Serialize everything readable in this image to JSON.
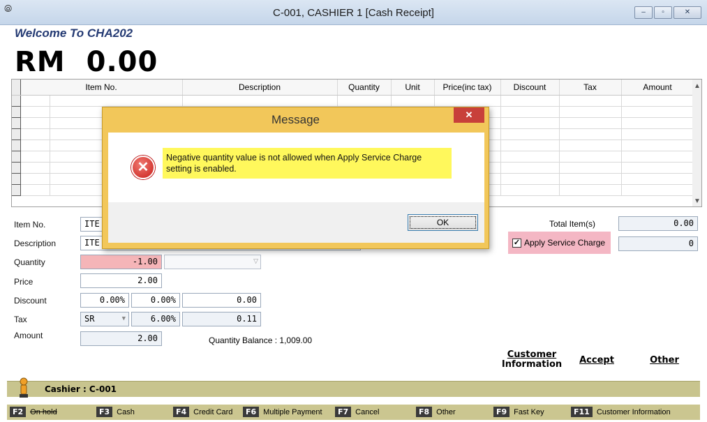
{
  "window": {
    "title": "C-001, CASHIER 1 [Cash Receipt]",
    "minimize": "–",
    "maximize": "▫",
    "close": "✕"
  },
  "header": {
    "welcome": "Welcome To CHA202",
    "currency": "RM",
    "total": "0.00"
  },
  "grid": {
    "columns": [
      "Item No.",
      "Description",
      "Quantity",
      "Unit",
      "Price(inc tax)",
      "Discount",
      "Tax",
      "Amount"
    ]
  },
  "form": {
    "item_no_label": "Item No.",
    "item_no_value": "ITE",
    "description_label": "Description",
    "description_value": "ITE",
    "quantity_label": "Quantity",
    "quantity_value": "-1.00",
    "price_label": "Price",
    "price_value": "2.00",
    "discount_label": "Discount",
    "discount_pct1": "0.00%",
    "discount_pct2": "0.00%",
    "discount_amount": "0.00",
    "tax_label": "Tax",
    "tax_code": "SR",
    "tax_rate": "6.00%",
    "tax_amount": "0.11",
    "amount_label": "Amount",
    "amount_value": "2.00",
    "quantity_balance": "Quantity Balance : 1,009.00"
  },
  "totals": {
    "total_items_label": "Total Item(s)",
    "total_items_value": "0.00",
    "service_charge_label": "Apply Service Charge",
    "service_charge_value": "0",
    "service_charge_checked": true
  },
  "actions": {
    "customer_information_line1": "Customer",
    "customer_information_line2": "Information",
    "accept": "Accept",
    "other": "Other"
  },
  "status": {
    "cashier": "Cashier : C-001"
  },
  "fkeys": [
    {
      "key": "F2",
      "label": "On hold"
    },
    {
      "key": "F3",
      "label": "Cash"
    },
    {
      "key": "F4",
      "label": "Credit Card"
    },
    {
      "key": "F6",
      "label": "Multiple Payment"
    },
    {
      "key": "F7",
      "label": "Cancel"
    },
    {
      "key": "F8",
      "label": "Other"
    },
    {
      "key": "F9",
      "label": "Fast Key"
    },
    {
      "key": "F11",
      "label": "Customer Information"
    }
  ],
  "dialog": {
    "title": "Message",
    "close": "✕",
    "icon": "error-icon",
    "message": "Negative quantity value is not allowed when Apply Service Charge setting is enabled.",
    "ok": "OK"
  },
  "colors": {
    "accent_dialog": "#f2c75a",
    "highlight_message": "#fff85c",
    "quantity_error": "#f5b5b8",
    "service_charge_bg": "#f4b7c4",
    "status_bar": "#c8c48e"
  }
}
